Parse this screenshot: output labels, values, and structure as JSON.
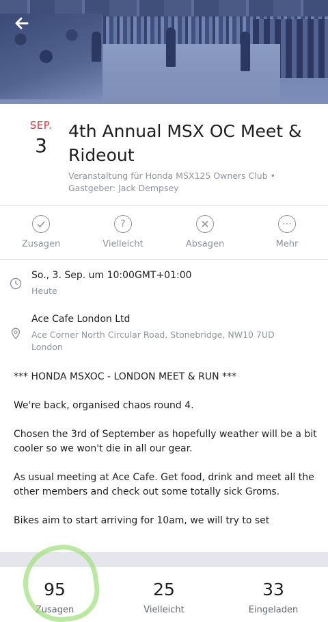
{
  "event": {
    "month": "SEP.",
    "day": "3",
    "title": "4th Annual MSX OC Meet & Rideout",
    "subtitle": "Veranstaltung für Honda MSX125 Owners Club • Gastgeber: Jack Dempsey"
  },
  "actions": [
    {
      "label": "Zusagen",
      "icon": "check-circle-icon",
      "glyph": "✓"
    },
    {
      "label": "Vielleicht",
      "icon": "question-circle-icon",
      "glyph": "?"
    },
    {
      "label": "Absagen",
      "icon": "x-circle-icon",
      "glyph": "✕"
    },
    {
      "label": "Mehr",
      "icon": "more-circle-icon",
      "glyph": "⋯"
    }
  ],
  "datetime": {
    "main": "So., 3. Sep. um 10:00GMT+01:00",
    "sub": "Heute"
  },
  "location": {
    "main": "Ace Cafe London Ltd",
    "sub": "Ace Corner North Circular Road, Stonebridge, NW10 7UD London"
  },
  "description": [
    "*** HONDA MSXOC - LONDON MEET & RUN ***",
    "We're back, organised chaos round 4.",
    "Chosen the 3rd of September as hopefully weather will be a bit cooler so we won't die in all our gear.",
    "As usual meeting at Ace Cafe. Get food, drink and meet all the other members and check out some totally sick Groms.",
    "Bikes aim to start arriving for 10am, we will try to set"
  ],
  "stats": [
    {
      "number": "95",
      "label": "Zusagen"
    },
    {
      "number": "25",
      "label": "Vielleicht"
    },
    {
      "number": "33",
      "label": "Eingeladen"
    }
  ],
  "colors": {
    "accent_red": "#e0393e",
    "muted_text": "#8d949e",
    "highlight_green": "#9ee07a"
  }
}
